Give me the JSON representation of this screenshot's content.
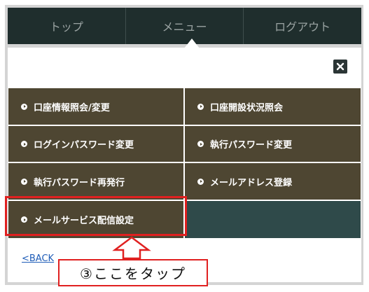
{
  "nav": {
    "items": [
      {
        "label": "トップ"
      },
      {
        "label": "メニュー"
      },
      {
        "label": "ログアウト"
      }
    ]
  },
  "menu": {
    "close_icon": "close-x-icon",
    "items": [
      {
        "label": "口座情報照会/変更"
      },
      {
        "label": "口座開設状況照会"
      },
      {
        "label": "ログインパスワード変更"
      },
      {
        "label": "執行パスワード変更"
      },
      {
        "label": "執行パスワード再発行"
      },
      {
        "label": "メールアドレス登録"
      },
      {
        "label": "メールサービス配信設定"
      }
    ]
  },
  "back_link": "<BACK",
  "annotation": {
    "callout_text": "③ここをタップ"
  },
  "colors": {
    "nav_bg": "#1f2e2d",
    "cell_bg": "#4e4632",
    "empty_cell_bg": "#2f4a4a",
    "highlight": "#e02020",
    "link": "#1f5db8"
  }
}
